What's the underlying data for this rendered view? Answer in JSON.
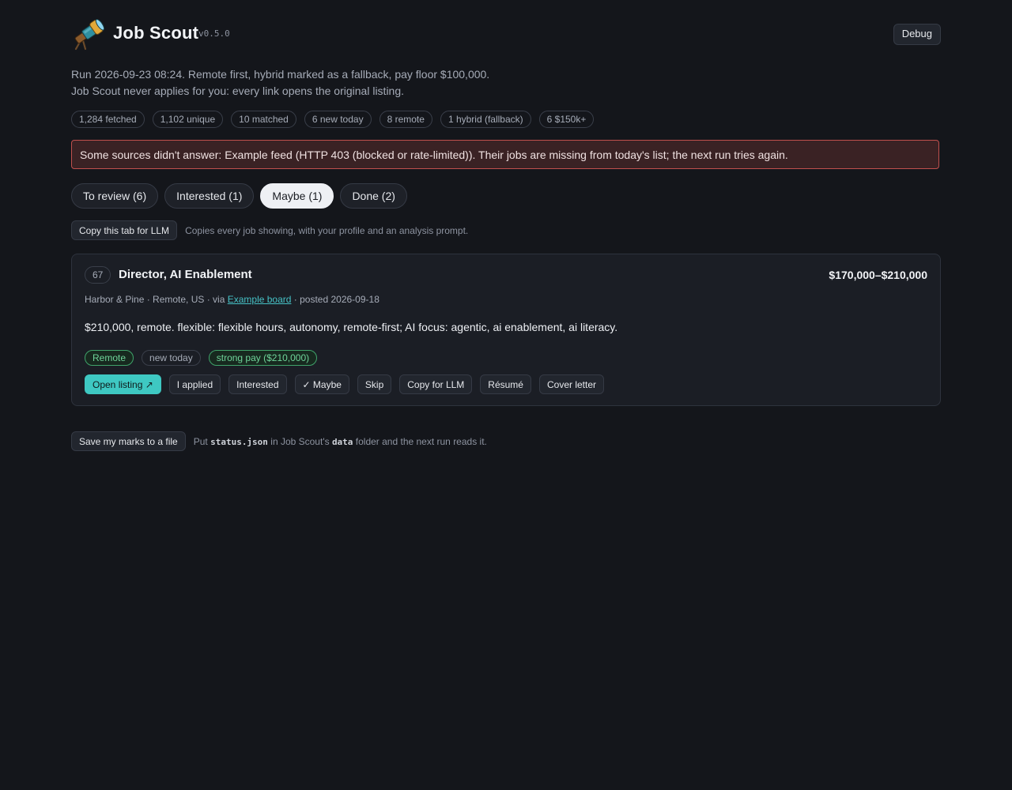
{
  "header": {
    "title": "Job Scout",
    "version": "v0.5.0",
    "debug_label": "Debug",
    "logo_icon": "telescope-icon"
  },
  "run_info": {
    "line1": "Run 2026-09-23 08:24. Remote first, hybrid marked as a fallback, pay floor $100,000.",
    "line2": "Job Scout never applies for you: every link opens the original listing."
  },
  "stats": [
    "1,284 fetched",
    "1,102 unique",
    "10 matched",
    "6 new today",
    "8 remote",
    "1 hybrid (fallback)",
    "6 $150k+"
  ],
  "alert": {
    "text": "Some sources didn't answer: Example feed (HTTP 403 (blocked or rate-limited)). Their jobs are missing from today's list; the next run tries again."
  },
  "tabs": [
    {
      "label": "To review (6)",
      "active": false
    },
    {
      "label": "Interested (1)",
      "active": false
    },
    {
      "label": "Maybe (1)",
      "active": true
    },
    {
      "label": "Done (2)",
      "active": false
    }
  ],
  "copy_tab": {
    "button_label": "Copy this tab for LLM",
    "hint": "Copies every job showing, with your profile and an analysis prompt."
  },
  "job": {
    "score": "67",
    "title": "Director, AI Enablement",
    "salary": "$170,000–$210,000",
    "company_location": "Harbor & Pine · Remote, US · via ",
    "source": "Example board",
    "posted": " · posted 2026-09-18",
    "summary": "$210,000, remote. flexible: flexible hours, autonomy, remote-first; AI focus: agentic, ai enablement, ai literacy.",
    "tags": [
      {
        "label": "Remote",
        "green": true
      },
      {
        "label": "new today",
        "green": false
      },
      {
        "label": "strong pay ($210,000)",
        "green": true
      }
    ],
    "actions": {
      "open_listing": "Open listing ↗",
      "applied": "I applied",
      "interested": "Interested",
      "maybe": "✓ Maybe",
      "skip": "Skip",
      "copy_llm": "Copy for LLM",
      "resume": "Résumé",
      "cover_letter": "Cover letter"
    }
  },
  "save": {
    "button_label": "Save my marks to a file",
    "hint_before": "Put ",
    "file_name": "status.json",
    "hint_middle": " in Job Scout's ",
    "folder_name": "data",
    "hint_after": " folder and the next run reads it."
  },
  "colors": {
    "background": "#14161b",
    "accent": "#3ec8c2",
    "alert_border": "#c0504d",
    "tag_green": "#6fd49a"
  }
}
